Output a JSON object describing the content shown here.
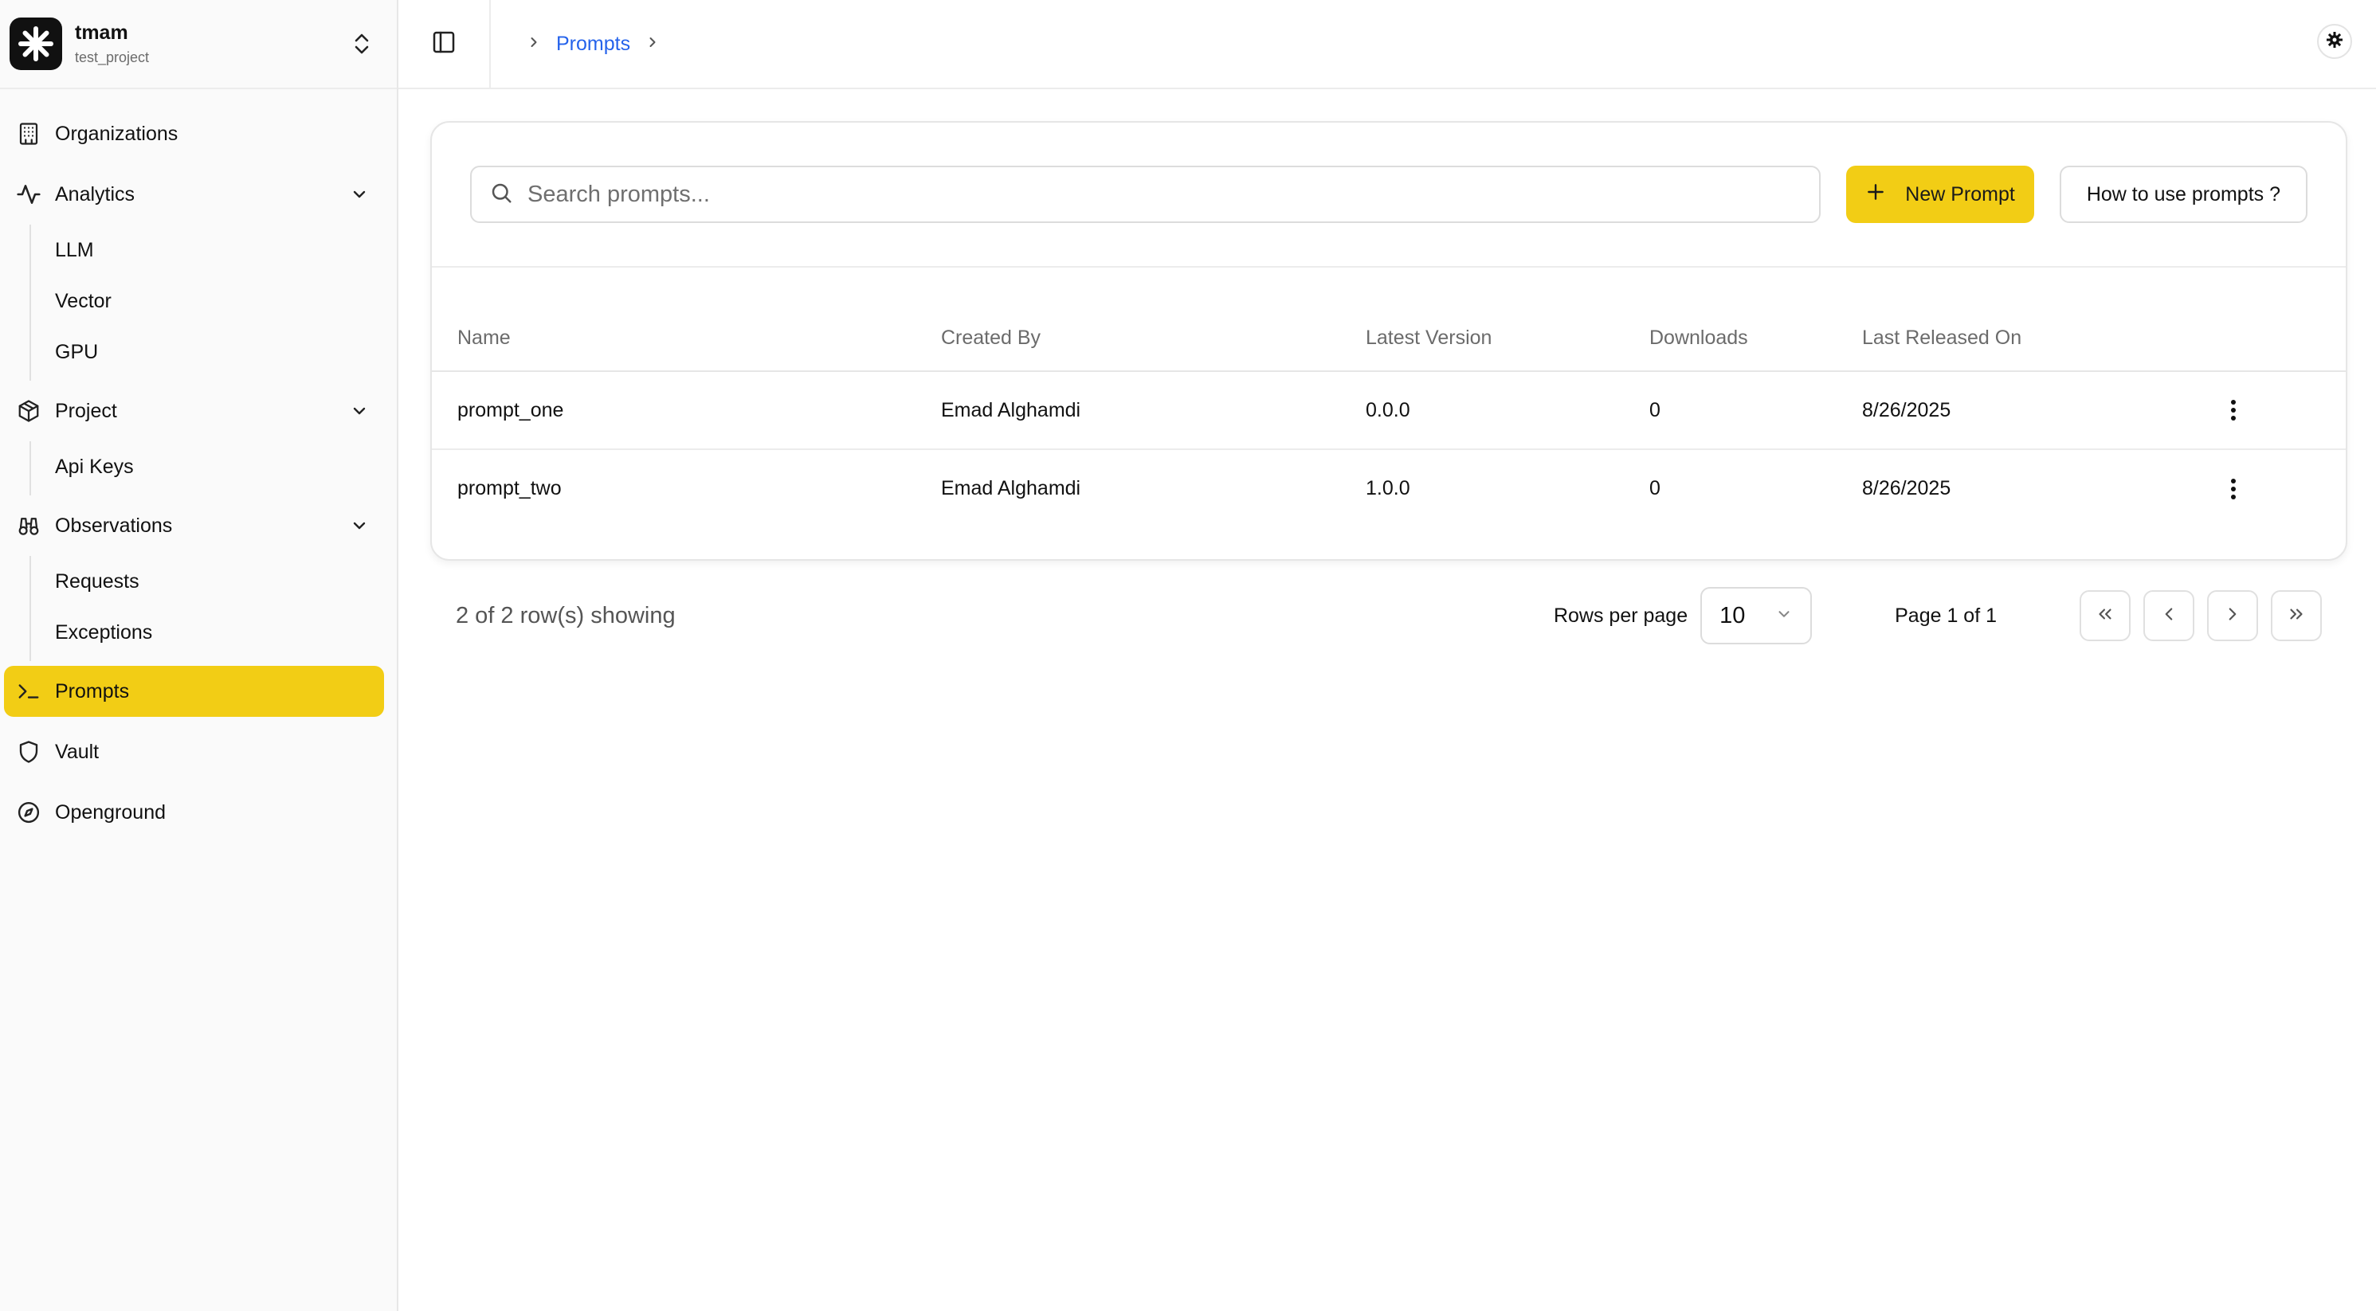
{
  "brand": {
    "name": "tmam",
    "project": "test_project"
  },
  "sidebar": {
    "items": [
      {
        "label": "Organizations",
        "icon": "building-icon"
      },
      {
        "label": "Analytics",
        "icon": "activity-icon",
        "children": [
          "LLM",
          "Vector",
          "GPU"
        ]
      },
      {
        "label": "Project",
        "icon": "package-icon",
        "children": [
          "Api Keys"
        ]
      },
      {
        "label": "Observations",
        "icon": "binoculars-icon",
        "children": [
          "Requests",
          "Exceptions"
        ]
      },
      {
        "label": "Prompts",
        "icon": "terminal-icon",
        "active": true
      },
      {
        "label": "Vault",
        "icon": "shield-icon"
      },
      {
        "label": "Openground",
        "icon": "compass-icon"
      }
    ]
  },
  "breadcrumb": {
    "current": "Prompts"
  },
  "toolbar": {
    "search_placeholder": "Search prompts...",
    "new_prompt_label": "New Prompt",
    "help_label": "How to use prompts ?"
  },
  "table": {
    "columns": [
      "Name",
      "Created By",
      "Latest Version",
      "Downloads",
      "Last Released On"
    ],
    "rows": [
      {
        "name": "prompt_one",
        "created_by": "Emad Alghamdi",
        "version": "0.0.0",
        "downloads": "0",
        "released": "8/26/2025"
      },
      {
        "name": "prompt_two",
        "created_by": "Emad Alghamdi",
        "version": "1.0.0",
        "downloads": "0",
        "released": "8/26/2025"
      }
    ]
  },
  "pagination": {
    "summary": "2 of 2 row(s) showing",
    "rows_per_page_label": "Rows per page",
    "rows_per_page_value": "10",
    "page_label": "Page 1 of 1"
  },
  "colors": {
    "accent": "#f2cd15",
    "link": "#2563eb",
    "sidebar_bg": "#fafafa"
  }
}
